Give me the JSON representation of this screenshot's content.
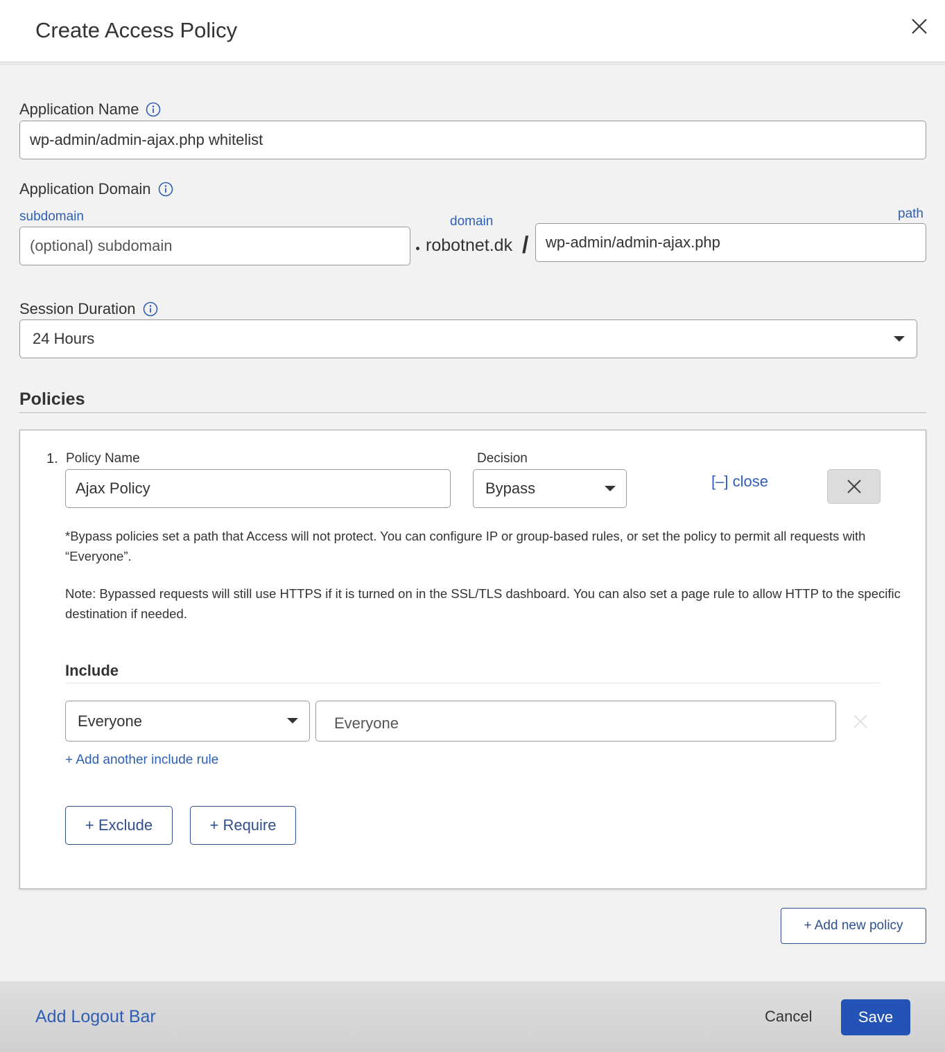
{
  "header": {
    "title": "Create Access Policy"
  },
  "application_name": {
    "label": "Application Name",
    "value": "wp-admin/admin-ajax.php whitelist"
  },
  "application_domain": {
    "label": "Application Domain",
    "subdomain_label": "subdomain",
    "subdomain_placeholder": "(optional) subdomain",
    "domain_label": "domain",
    "domain_value": "robotnet.dk",
    "slash": "/",
    "path_label": "path",
    "path_value": "wp-admin/admin-ajax.php"
  },
  "session_duration": {
    "label": "Session Duration",
    "value": "24 Hours"
  },
  "policies": {
    "title": "Policies",
    "items": [
      {
        "number": "1.",
        "name_label": "Policy Name",
        "name_value": "Ajax Policy",
        "decision_label": "Decision",
        "decision_value": "Bypass",
        "close_label": "[–] close",
        "note_1": "*Bypass policies set a path that Access will not protect. You can configure IP or group-based rules, or set the policy to permit all requests with “Everyone”.",
        "note_2": "Note: Bypassed requests will still use HTTPS if it is turned on in the SSL/TLS dashboard. You can also set a page rule to allow HTTP to the specific destination if needed.",
        "include": {
          "title": "Include",
          "rule_type": "Everyone",
          "rule_value": "Everyone",
          "add_rule_label": "+ Add another include rule"
        },
        "exclude_label": "+ Exclude",
        "require_label": "+ Require"
      }
    ],
    "add_policy_label": "+ Add new policy"
  },
  "footer": {
    "logout_bar_label": "Add Logout Bar",
    "cancel_label": "Cancel",
    "save_label": "Save"
  },
  "colors": {
    "accent": "#2453b8",
    "link": "#2f5fb4"
  }
}
